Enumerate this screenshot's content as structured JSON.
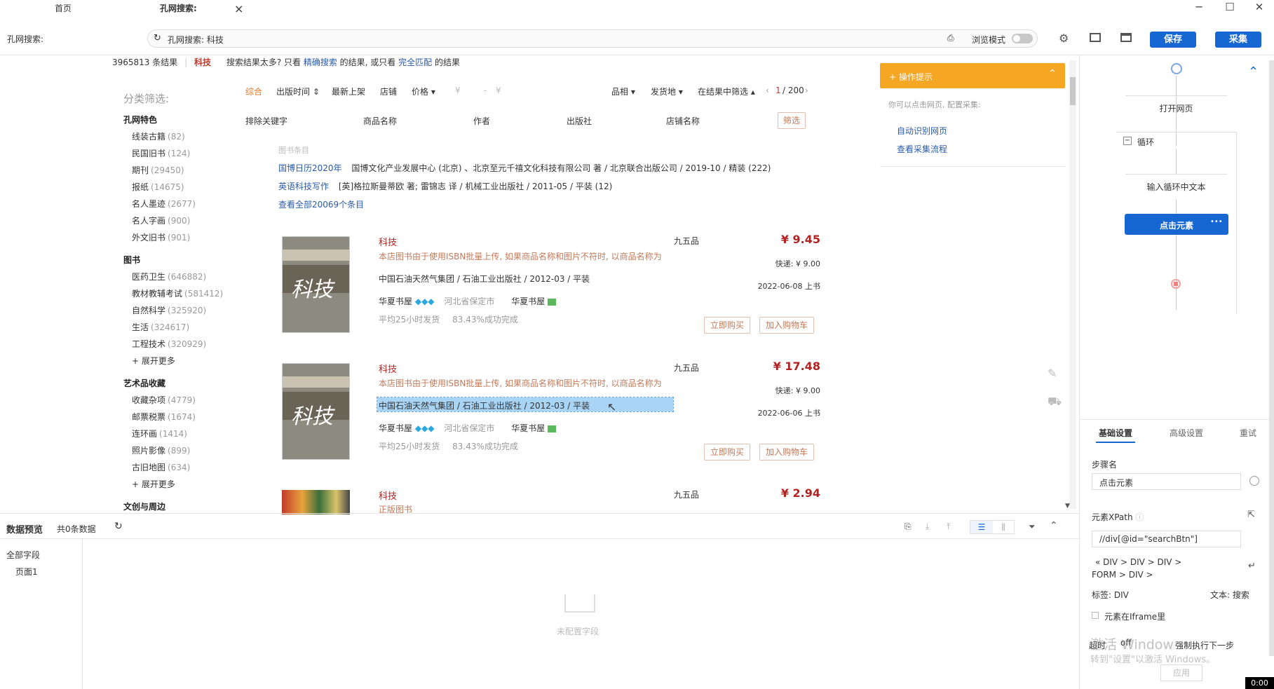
{
  "tabs": {
    "home": "首页",
    "search": "孔网搜索:",
    "close": "×"
  },
  "window": {
    "minimize": "─",
    "maximize": "☐",
    "close": "✕"
  },
  "address": {
    "label": "孔网搜索:",
    "url": "孔网搜索: 科技",
    "browse_mode": "浏览模式",
    "save": "保存",
    "collect": "采集"
  },
  "results": {
    "count": "3965813 条结果",
    "keyword": "科技",
    "hint_pre": "搜索结果太多? 只看",
    "hint_link1": "精确搜索",
    "hint_mid": "的结果, 或只看",
    "hint_link2": "完全匹配",
    "hint_post": "的结果"
  },
  "sidebar": {
    "title": "分类筛选:",
    "groups": [
      {
        "name": "孔网特色",
        "items": [
          {
            "label": "线装古籍",
            "count": "(82)"
          },
          {
            "label": "民国旧书",
            "count": "(124)"
          },
          {
            "label": "期刊",
            "count": "(29450)"
          },
          {
            "label": "报纸",
            "count": "(14675)"
          },
          {
            "label": "名人墨迹",
            "count": "(2677)"
          },
          {
            "label": "名人字画",
            "count": "(900)"
          },
          {
            "label": "外文旧书",
            "count": "(901)"
          }
        ]
      },
      {
        "name": "图书",
        "items": [
          {
            "label": "医药卫生",
            "count": "(646882)"
          },
          {
            "label": "教材教辅考试",
            "count": "(581412)"
          },
          {
            "label": "自然科学",
            "count": "(325920)"
          },
          {
            "label": "生活",
            "count": "(324617)"
          },
          {
            "label": "工程技术",
            "count": "(320929)"
          }
        ],
        "more": "+ 展开更多"
      },
      {
        "name": "艺术品收藏",
        "items": [
          {
            "label": "收藏杂项",
            "count": "(4779)"
          },
          {
            "label": "邮票税票",
            "count": "(1674)"
          },
          {
            "label": "连环画",
            "count": "(1414)"
          },
          {
            "label": "照片影像",
            "count": "(899)"
          },
          {
            "label": "古旧地图",
            "count": "(634)"
          }
        ],
        "more": "+ 展开更多"
      },
      {
        "name": "文创与周边",
        "items": []
      }
    ]
  },
  "sortbar": {
    "comprehensive": "综合",
    "pubtime": "出版时间 ⇕",
    "newest": "最新上架",
    "shop": "店铺",
    "price": "价格 ▾",
    "yen1": "¥",
    "dash": "-",
    "yen2": "¥",
    "quality": "品相 ▾",
    "ship": "发货地 ▾",
    "filter_in": "在结果中筛选 ▴",
    "page_prev": "‹",
    "page_cur": "1",
    "page_total": "/ 200",
    "page_next": "›"
  },
  "filterbar": {
    "exclude": "排除关键字",
    "product": "商品名称",
    "author": "作者",
    "publisher": "出版社",
    "shopname": "店铺名称",
    "btn": "筛选"
  },
  "entries": {
    "title": "图书条目",
    "e1_link": "国博日历2020年",
    "e1_text": "国博文化产业发展中心 (北京) 、北京至元千禧文化科技有限公司 著 / 北京联合出版公司 / 2019-10 / 精装 (222)",
    "e2_link": "英语科技写作",
    "e2_text": "[英]格拉斯曼蒂欧 著; 雷锦志 译 / 机械工业出版社 / 2011-05 / 平装 (12)",
    "all": "查看全部20069个条目"
  },
  "products": [
    {
      "title": "科技",
      "desc": "本店图书由于使用ISBN批量上传, 如果商品名称和图片不符时, 以商品名称为",
      "pub": "中国石油天然气集团 / 石油工业出版社 / 2012-03 / 平装",
      "shop": "华夏书屋",
      "loc": "河北省保定市",
      "shop2": "华夏书屋",
      "stats": "平均25小时发货",
      "rate": "83.43%成功完成",
      "cond": "九五品",
      "price": "¥ 9.45",
      "ship": "快递: ¥ 9.00",
      "date": "2022-06-08 上书",
      "buy": "立即购买",
      "cart": "加入购物车"
    },
    {
      "title": "科技",
      "desc": "本店图书由于使用ISBN批量上传, 如果商品名称和图片不符时, 以商品名称为",
      "pub": "中国石油天然气集团 / 石油工业出版社 / 2012-03 / 平装",
      "shop": "华夏书屋",
      "loc": "河北省保定市",
      "shop2": "华夏书屋",
      "stats": "平均25小时发货",
      "rate": "83.43%成功完成",
      "cond": "九五品",
      "price": "¥ 17.48",
      "ship": "快递: ¥ 9.00",
      "date": "2022-06-06 上书",
      "buy": "立即购买",
      "cart": "加入购物车"
    },
    {
      "title": "科技",
      "desc": "正版图书",
      "cond": "九五品",
      "price": "¥ 2.94"
    }
  ],
  "book_cover_text": "科技",
  "tips": {
    "title": "+ 操作提示",
    "text": "你可以点击网页, 配置采集:",
    "link1": "自动识别网页",
    "link2": "查看采集流程",
    "collapse": "«"
  },
  "flow": {
    "open": "打开网页",
    "loop": "循环",
    "input": "输入循环中文本",
    "click": "点击元素",
    "dots": "•••"
  },
  "settings": {
    "tabs": [
      "基础设置",
      "高级设置",
      "重试"
    ],
    "step_label": "步骤名",
    "step_value": "点击元素",
    "xpath_label": "元素XPath",
    "xpath_value": "//div[@id=\"searchBtn\"]",
    "path1": "« DIV  >  DIV  >  DIV  >",
    "path2": "FORM  >  DIV  >",
    "tag_label": "标签:",
    "tag_value": "DIV",
    "text_label": "文本:",
    "text_value": "搜索",
    "iframe": "元素在Iframe里",
    "timeout": "超时",
    "off": "off",
    "force": "强制执行下一步",
    "apply": "应用",
    "watermark1": "激活 Window",
    "watermark2": "转到\"设置\"以激活 Windows。"
  },
  "preview": {
    "title": "数据预览",
    "count": "共0条数据",
    "all_fields": "全部字段",
    "page1": "页面1",
    "empty": "未配置字段"
  },
  "timer": "0:00",
  "colors": {
    "accent": "#1767d2",
    "tips_orange": "#f5a623",
    "price_red": "#b22222"
  }
}
